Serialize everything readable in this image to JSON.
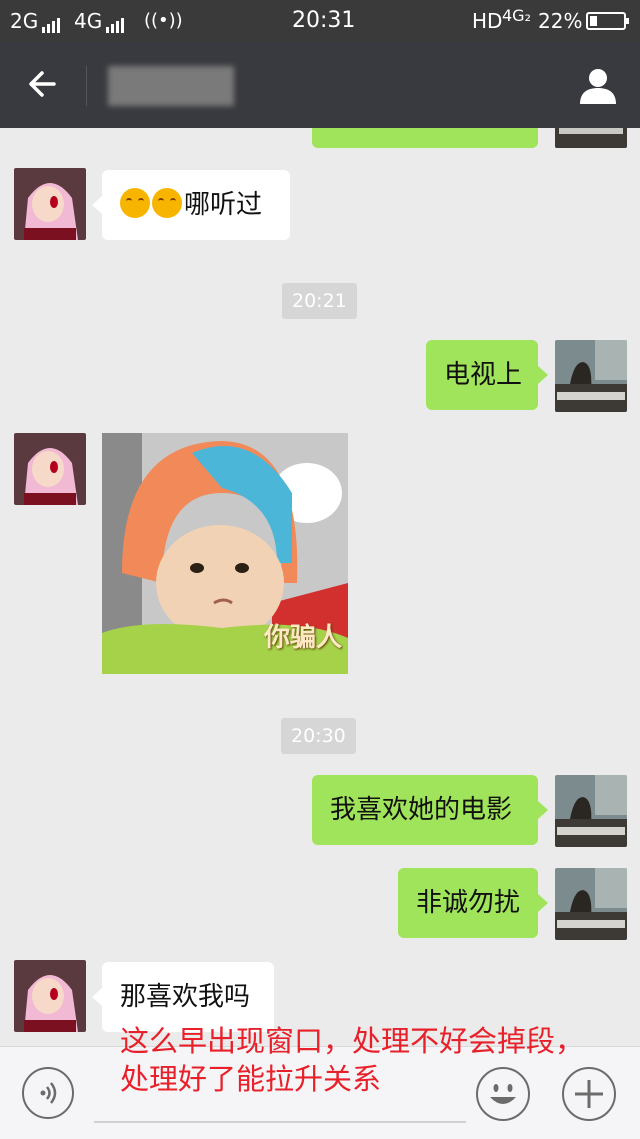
{
  "status_bar": {
    "network1": "2G",
    "network2": "4G",
    "time": "20:31",
    "hd": "HD",
    "net_type": "4G₂",
    "battery": "22%",
    "battery_fraction": 0.22
  },
  "nav": {
    "contact_name": ""
  },
  "messages": {
    "m1": {
      "text": "哪听过"
    },
    "t1": "20:21",
    "m2": {
      "text": "电视上"
    },
    "sticker": {
      "caption": "你骗人"
    },
    "t2": "20:30",
    "m3": {
      "text": "我喜欢她的电影"
    },
    "m4": {
      "text": "非诚勿扰"
    },
    "m5": {
      "text": "那喜欢我吗"
    }
  },
  "overlay_text": {
    "line1": "这么早出现窗口，处理不好会掉段，",
    "line2": "处理好了能拉升关系"
  },
  "colors": {
    "outgoing_bubble": "#9fe45a",
    "incoming_bubble": "#ffffff",
    "navbar": "#393a3f",
    "overlay_text": "#e8202a"
  }
}
